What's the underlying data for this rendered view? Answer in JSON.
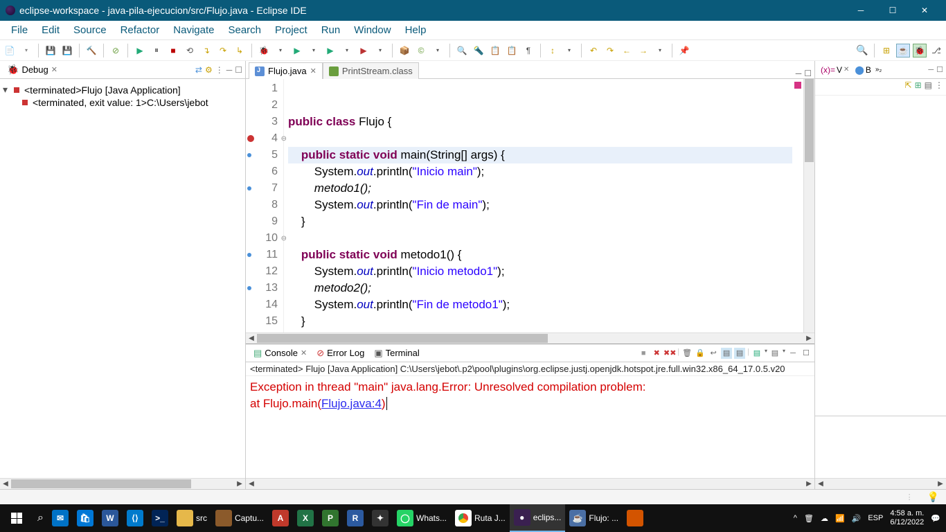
{
  "title": "eclipse-workspace - java-pila-ejecucion/src/Flujo.java - Eclipse IDE",
  "menu": [
    "File",
    "Edit",
    "Source",
    "Refactor",
    "Navigate",
    "Search",
    "Project",
    "Run",
    "Window",
    "Help"
  ],
  "debug": {
    "tab": "Debug",
    "root": "<terminated>Flujo [Java Application]",
    "child": "<terminated, exit value: 1>C:\\Users\\jebot"
  },
  "editor": {
    "tabs": [
      {
        "label": "Flujo.java",
        "active": true,
        "icon": "java"
      },
      {
        "label": "PrintStream.class",
        "active": false,
        "icon": "class"
      }
    ],
    "lines": [
      "1",
      "2",
      "3",
      "4",
      "5",
      "6",
      "7",
      "8",
      "9",
      "10",
      "11",
      "12",
      "13",
      "14",
      "15"
    ]
  },
  "code": {
    "l2a": "public",
    "l2b": "class",
    "l2c": " Flujo {",
    "l4a": "public",
    "l4b": "static",
    "l4c": "void",
    "l4d": " main(String[] args) {",
    "l5a": "System.",
    "l5b": "out",
    "l5c": ".println(",
    "l5d": "\"Inicio main\"",
    "l5e": ");",
    "l6": "metodo1();",
    "l7a": "System.",
    "l7b": "out",
    "l7c": ".println(",
    "l7d": "\"Fin de main\"",
    "l7e": ");",
    "l8": "}",
    "l10a": "public",
    "l10b": "static",
    "l10c": "void",
    "l10d": " metodo1() {",
    "l11a": "System.",
    "l11b": "out",
    "l11c": ".println(",
    "l11d": "\"Inicio metodo1\"",
    "l11e": ");",
    "l12": "metodo2();",
    "l13a": "System.",
    "l13b": "out",
    "l13c": ".println(",
    "l13d": "\"Fin de metodo1\"",
    "l13e": ");",
    "l14": "}"
  },
  "bottom": {
    "tabs": [
      "Console",
      "Error Log",
      "Terminal"
    ],
    "status": "<terminated> Flujo [Java Application] C:\\Users\\jebot\\.p2\\pool\\plugins\\org.eclipse.justj.openjdk.hotspot.jre.full.win32.x86_64_17.0.5.v20",
    "line1": "Exception in thread \"main\" java.lang.Error: Unresolved compilation problem: ",
    "line2a": "\tat Flujo.main(",
    "line2link": "Flujo.java:4",
    "line2b": ")"
  },
  "rp": {
    "v": "V",
    "b": "B"
  },
  "taskbar": {
    "items": [
      {
        "label": "src",
        "color": "#e6b84a"
      },
      {
        "label": "Captu...",
        "color": "#8b5a2b"
      },
      {
        "label": "",
        "color": "#c0392b",
        "txt": "A"
      },
      {
        "label": "",
        "color": "#217346",
        "txt": "X"
      },
      {
        "label": "",
        "color": "#31752f",
        "txt": "P"
      },
      {
        "label": "",
        "color": "#2c5aa0",
        "txt": "R"
      },
      {
        "label": "",
        "color": "#333",
        "txt": "✦"
      },
      {
        "label": "Whats...",
        "color": "#25d366",
        "txt": "◯"
      },
      {
        "label": "Ruta J...",
        "color": "#fff",
        "chrome": true
      },
      {
        "label": "eclips...",
        "color": "#3a2050",
        "txt": "●",
        "active": true
      },
      {
        "label": "Flujo: ...",
        "color": "#4a6fa5",
        "txt": "☕"
      },
      {
        "label": "",
        "color": "#d35400",
        "txt": ""
      }
    ],
    "pinned": [
      "📧",
      "🛍",
      "W",
      "VS",
      "PS"
    ],
    "lang": "ESP",
    "time": "4:58 a. m.",
    "date": "6/12/2022"
  }
}
